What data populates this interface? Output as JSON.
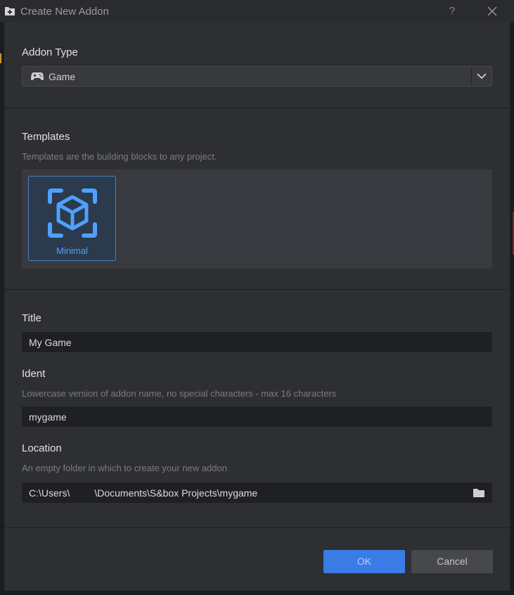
{
  "window": {
    "title": "Create New Addon",
    "help_label": "?"
  },
  "addon_type": {
    "label": "Addon Type",
    "selected": "Game"
  },
  "templates": {
    "label": "Templates",
    "hint": "Templates are the building blocks to any project.",
    "items": [
      {
        "label": "Minimal",
        "selected": true
      }
    ]
  },
  "title_field": {
    "label": "Title",
    "value": "My Game"
  },
  "ident_field": {
    "label": "Ident",
    "hint": "Lowercase version of addon name, no special characters - max 16 characters",
    "value": "mygame"
  },
  "location_field": {
    "label": "Location",
    "hint": "An empty folder in which to create your new addon",
    "value": "C:\\Users\\         \\Documents\\S&box Projects\\mygame"
  },
  "buttons": {
    "ok_label": "OK",
    "cancel_label": "Cancel"
  },
  "colors": {
    "accent": "#3a7ce6",
    "template_accent": "#4ea1ff",
    "dialog_bg": "#2e2f33"
  }
}
